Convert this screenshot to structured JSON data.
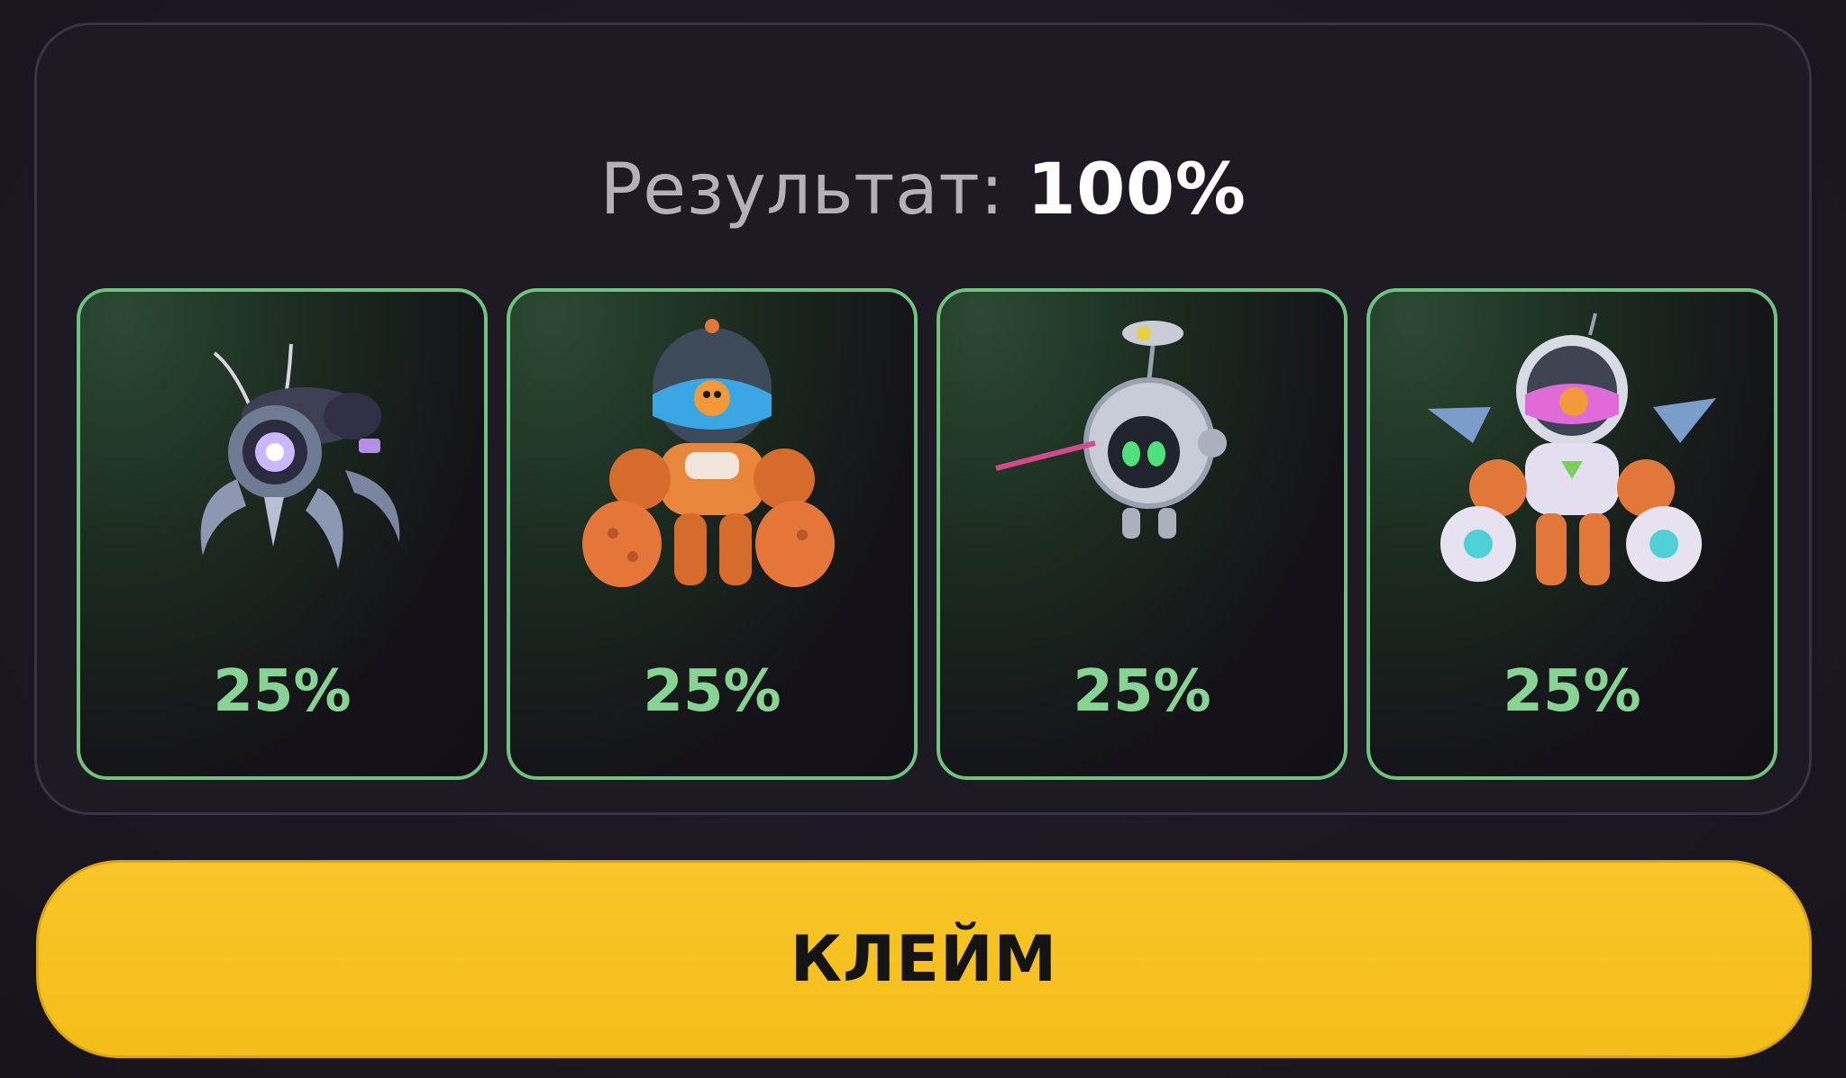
{
  "result": {
    "label": "Результат:",
    "value": "100%"
  },
  "cards": [
    {
      "icon": "mech-spider-icon",
      "percent": "25%"
    },
    {
      "icon": "diver-robot-icon",
      "percent": "25%"
    },
    {
      "icon": "orb-drone-icon",
      "percent": "25%"
    },
    {
      "icon": "winged-mech-icon",
      "percent": "25%"
    }
  ],
  "claim_button": {
    "label": "КЛЕЙМ"
  },
  "colors": {
    "background": "#1d1923",
    "card_border": "#6fc37f",
    "percent_text": "#86d393",
    "button": "#f6c21f",
    "button_text": "#141414"
  }
}
